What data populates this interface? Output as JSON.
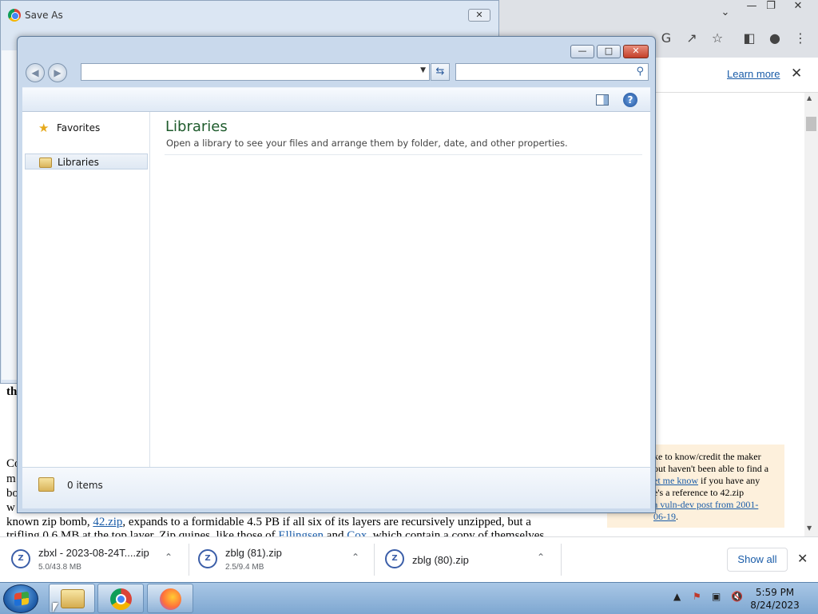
{
  "browser": {
    "learn_more": "Learn more",
    "article": {
      "bold_fragment": "th",
      "line1_start": "Co",
      "line2_start": "m",
      "line3_start": "bo",
      "line4_start": "w",
      "line5": {
        "before": "known zip bomb, ",
        "link1": "42.zip",
        "after": ", expands to a formidable 4.5 PB if all six of its layers are recursively unzipped, but a"
      },
      "line6": {
        "before": "trifling 0.6 MB at the top layer. Zip quines, like those of ",
        "link1": "Ellingsen",
        "mid": " and ",
        "link2": "Cox",
        "after": ", which contain a copy of themselves"
      }
    },
    "sidebar_note": {
      "line1": "ke to know/credit the maker",
      "line2": "out haven't been able to find a",
      "line3_link": "et me know",
      "line3_rest": " if you have any",
      "line4": "e's a reference to 42.zip",
      "line5_link": " a vuln-dev post from 2001-",
      "line6_link": "06-19",
      "line6_rest": "."
    }
  },
  "save_as": {
    "title": "Save As"
  },
  "libraries_window": {
    "nav_pane": {
      "favorites": "Favorites",
      "libraries": "Libraries"
    },
    "content": {
      "title": "Libraries",
      "subtitle": "Open a library to see your files and arrange them by folder, date, and other properties."
    },
    "details": {
      "items_count": "0 items"
    },
    "address_value": "",
    "search_placeholder": ""
  },
  "downloads": [
    {
      "name": "zbxl - 2023-08-24T....zip",
      "size": "5.0/43.8 MB"
    },
    {
      "name": "zblg (81).zip",
      "size": "2.5/9.4 MB"
    },
    {
      "name": "zblg (80).zip",
      "size": ""
    }
  ],
  "downloads_bar": {
    "show_all": "Show all"
  },
  "taskbar": {
    "time": "5:59 PM",
    "date": "8/24/2023"
  },
  "icons": [
    "chrome-icon",
    "google-icon",
    "share-icon",
    "star-icon",
    "side-panel-icon",
    "profile-icon",
    "menu-icon",
    "close-icon",
    "back-icon",
    "forward-icon",
    "refresh-icon",
    "search-icon",
    "preview-pane-icon",
    "help-icon",
    "favorites-star-icon",
    "library-icon",
    "zip-file-icon",
    "chevron-up-icon",
    "start-orb-icon",
    "explorer-icon",
    "firefox-icon",
    "volume-muted-icon",
    "network-icon",
    "flag-icon"
  ]
}
